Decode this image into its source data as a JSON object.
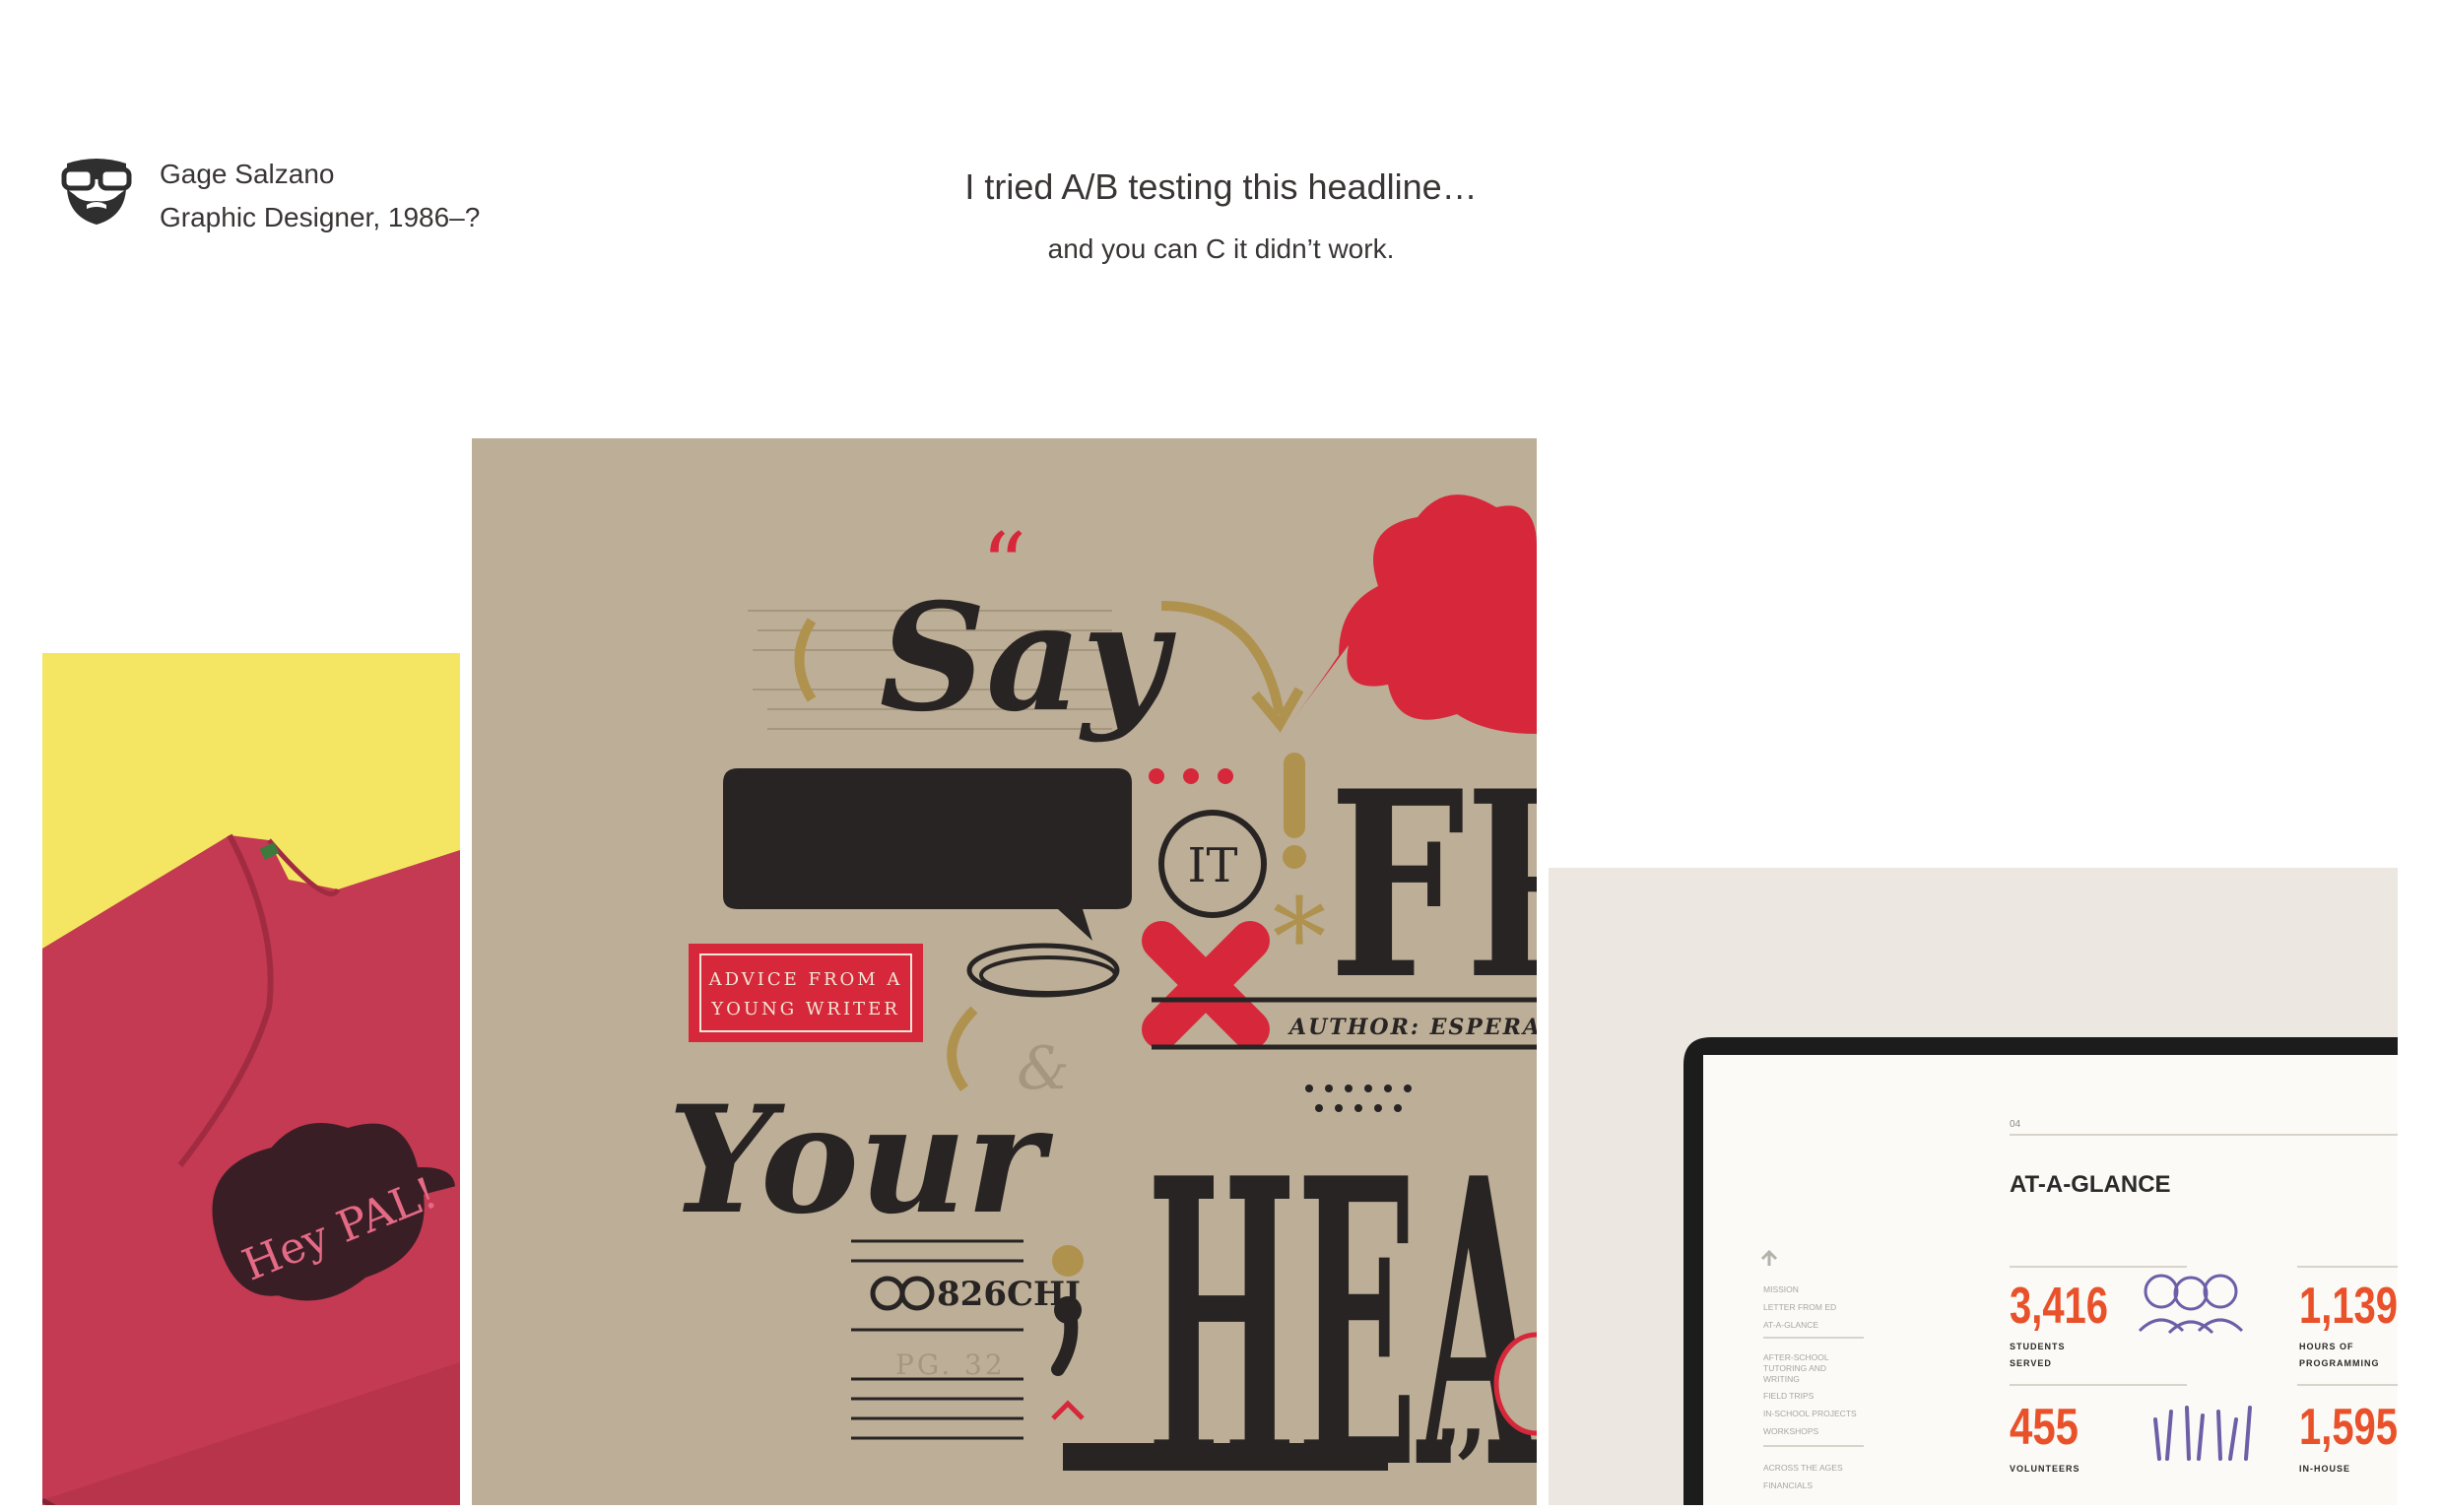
{
  "brand": {
    "name": "Gage Salzano",
    "tagline": "Graphic Designer, 1986–?",
    "logo_icon": "bearded-face-glasses-icon"
  },
  "hero": {
    "headline": "I tried A/B testing this headline…",
    "subline": "and you can C it didn’t work."
  },
  "tiles": {
    "shirt": {
      "print_text": "Hey PAL!",
      "background": "#f4e663",
      "shirt_color": "#c33a52"
    },
    "poster": {
      "word_say": "Say",
      "word_it": "IT",
      "word_your": "Your",
      "letters_fr": "FR",
      "letters_hea": "HEA",
      "badge_line1": "ADVICE FROM A",
      "badge_line2": "YOUNG WRITER",
      "author": "AUTHOR: ESPERANZ",
      "code": "826CHI",
      "page": "PG. 32",
      "background": "#bdae97",
      "accent": "#d6283a"
    },
    "report": {
      "section_no": "04",
      "title": "AT-A-GLANCE",
      "nav": [
        "MISSION",
        "LETTER FROM ED",
        "AT-A-GLANCE",
        "AFTER-SCHOOL",
        "TUTORING AND",
        "WRITING",
        "FIELD TRIPS",
        "IN-SCHOOL PROJECTS",
        "WORKSHOPS",
        "ACROSS THE AGES",
        "FINANCIALS"
      ],
      "stats": [
        {
          "value": "3,416",
          "label1": "STUDENTS",
          "label2": "SERVED"
        },
        {
          "value": "1,139",
          "label1": "HOURS OF",
          "label2": "PROGRAMMING"
        },
        {
          "value": "455",
          "label1": "VOLUNTEERS",
          "label2": ""
        },
        {
          "value": "1,595",
          "label1": "IN-HOUSE",
          "label2": ""
        }
      ],
      "accent": "#e8512a"
    }
  }
}
